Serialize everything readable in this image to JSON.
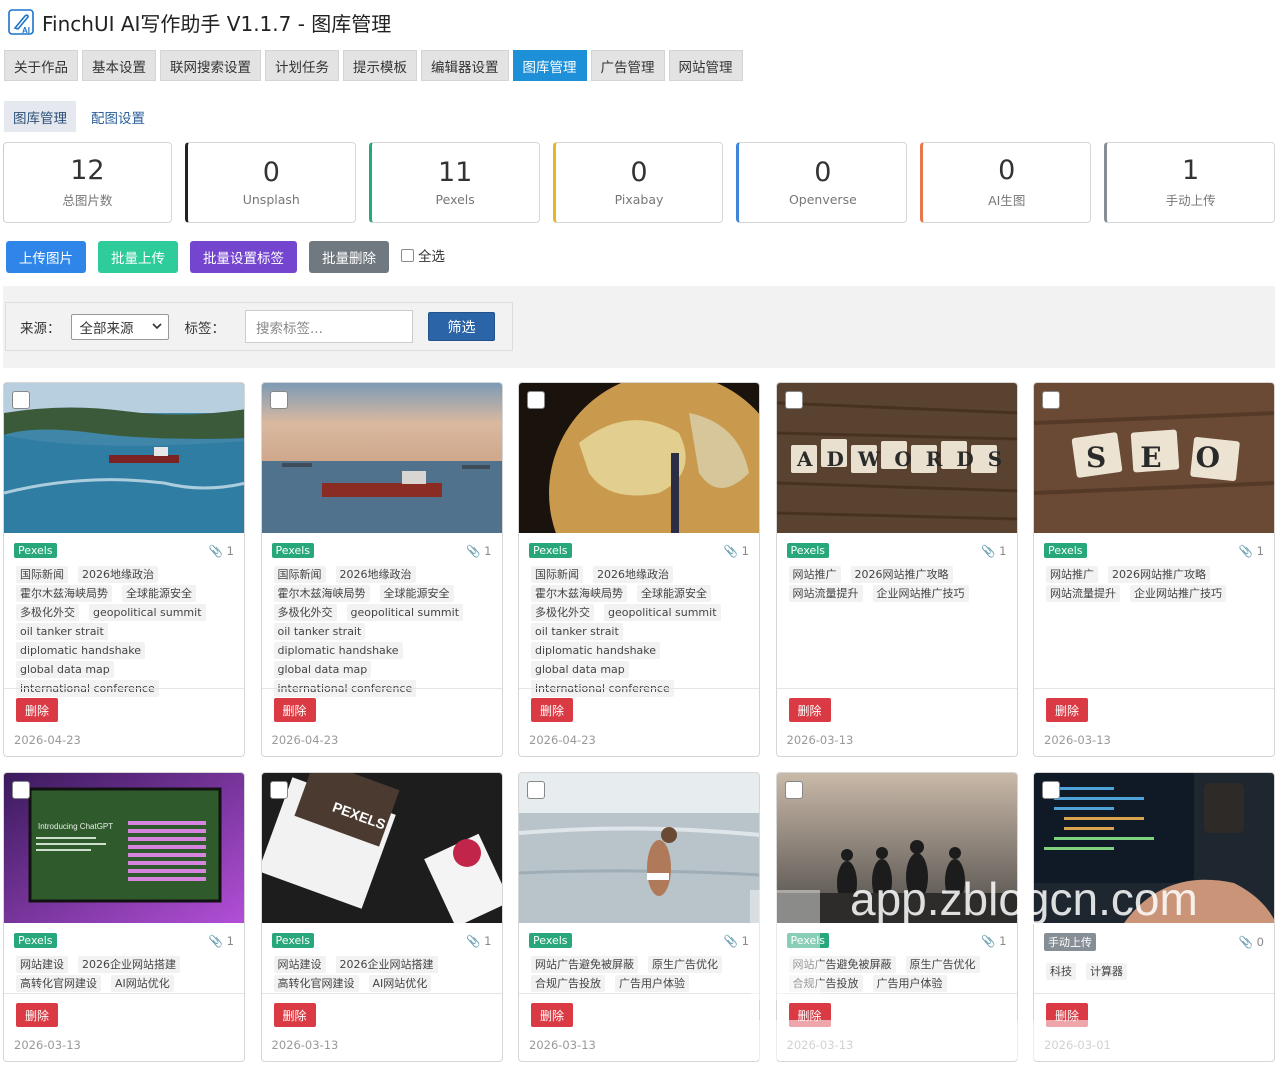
{
  "app": {
    "title": "FinchUI AI写作助手 V1.1.7 - 图库管理"
  },
  "main_tabs": [
    "关于作品",
    "基本设置",
    "联网搜索设置",
    "计划任务",
    "提示模板",
    "编辑器设置",
    "图库管理",
    "广告管理",
    "网站管理"
  ],
  "sub_tabs": [
    "图库管理",
    "配图设置"
  ],
  "stats": [
    {
      "num": "12",
      "label": "总图片数",
      "color": "#cccccc"
    },
    {
      "num": "0",
      "label": "Unsplash",
      "color": "#222222"
    },
    {
      "num": "11",
      "label": "Pexels",
      "color": "#27a77a"
    },
    {
      "num": "0",
      "label": "Pixabay",
      "color": "#e6b62a"
    },
    {
      "num": "0",
      "label": "Openverse",
      "color": "#3f86d9"
    },
    {
      "num": "0",
      "label": "AI生图",
      "color": "#e8774a"
    },
    {
      "num": "1",
      "label": "手动上传",
      "color": "#888e96"
    }
  ],
  "actions": {
    "upload": "上传图片",
    "batch_upload": "批量上传",
    "batch_tag": "批量设置标签",
    "batch_delete": "批量删除",
    "select_all": "全选"
  },
  "filter": {
    "source_label": "来源：",
    "source_value": "全部来源",
    "tag_label": "标签：",
    "tag_placeholder": "搜索标签...",
    "submit": "筛选"
  },
  "watermark": "app.zblogcn.com",
  "cards": [
    {
      "source": "Pexels",
      "count": "1",
      "tags": [
        "国际新闻",
        "2026地缘政治",
        "霍尔木兹海峡局势",
        "全球能源安全",
        "多极化外交",
        "geopolitical summit",
        "oil tanker strait",
        "diplomatic handshake",
        "global data map",
        "international conference"
      ],
      "delete": "删除",
      "date": "2026-04-23"
    },
    {
      "source": "Pexels",
      "count": "1",
      "tags": [
        "国际新闻",
        "2026地缘政治",
        "霍尔木兹海峡局势",
        "全球能源安全",
        "多极化外交",
        "geopolitical summit",
        "oil tanker strait",
        "diplomatic handshake",
        "global data map",
        "international conference"
      ],
      "delete": "删除",
      "date": "2026-04-23"
    },
    {
      "source": "Pexels",
      "count": "1",
      "tags": [
        "国际新闻",
        "2026地缘政治",
        "霍尔木兹海峡局势",
        "全球能源安全",
        "多极化外交",
        "geopolitical summit",
        "oil tanker strait",
        "diplomatic handshake",
        "global data map",
        "international conference"
      ],
      "delete": "删除",
      "date": "2026-04-23"
    },
    {
      "source": "Pexels",
      "count": "1",
      "tags": [
        "网站推广",
        "2026网站推广攻略",
        "网站流量提升",
        "企业网站推广技巧"
      ],
      "delete": "删除",
      "date": "2026-03-13",
      "img_text": "ADWORDS"
    },
    {
      "source": "Pexels",
      "count": "1",
      "tags": [
        "网站推广",
        "2026网站推广攻略",
        "网站流量提升",
        "企业网站推广技巧"
      ],
      "delete": "删除",
      "date": "2026-03-13",
      "img_text": "SEO"
    },
    {
      "source": "Pexels",
      "count": "1",
      "tags": [
        "网站建设",
        "2026企业网站搭建",
        "高转化官网建设",
        "AI网站优化"
      ],
      "delete": "删除",
      "date": "2026-03-13",
      "img_text": "Introducing ChatGPT"
    },
    {
      "source": "Pexels",
      "count": "1",
      "tags": [
        "网站建设",
        "2026企业网站搭建",
        "高转化官网建设",
        "AI网站优化"
      ],
      "delete": "删除",
      "date": "2026-03-13",
      "img_text": "PEXELS"
    },
    {
      "source": "Pexels",
      "count": "1",
      "tags": [
        "网站广告避免被屏蔽",
        "原生广告优化",
        "合规广告投放",
        "广告用户体验"
      ],
      "delete": "删除",
      "date": "2026-03-13"
    },
    {
      "source": "Pexels",
      "count": "1",
      "tags": [
        "网站广告避免被屏蔽",
        "原生广告优化",
        "合规广告投放",
        "广告用户体验"
      ],
      "delete": "删除",
      "date": "2026-03-13"
    },
    {
      "source": "手动上传",
      "count": "0",
      "tags": [
        "科技",
        "计算器"
      ],
      "delete": "删除",
      "date": "2026-03-01"
    }
  ]
}
